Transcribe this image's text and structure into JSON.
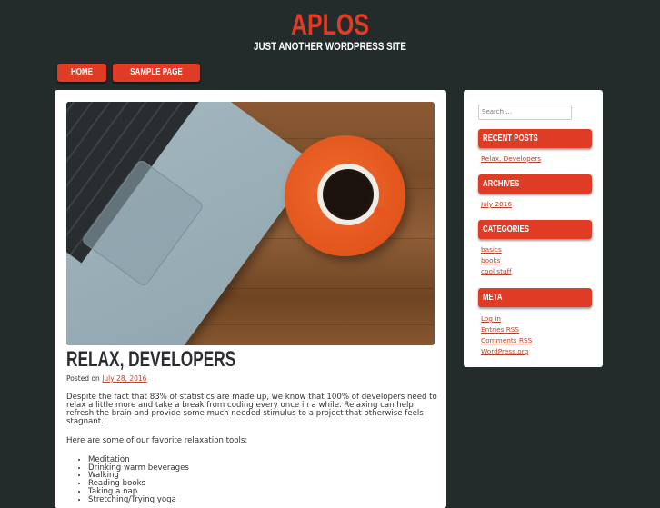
{
  "site": {
    "title": "APLOS",
    "description": "Just another WordPress site"
  },
  "nav": {
    "items": [
      {
        "label": "HOME"
      },
      {
        "label": "SAMPLE PAGE"
      }
    ]
  },
  "post": {
    "featured_image_alt": "laptop-and-coffee-photo",
    "title": "RELAX, DEVELOPERS",
    "meta_prefix": "Posted on",
    "date": "July 28, 2016",
    "paragraphs": [
      "Despite the fact that 83% of statistics are made up, we know that 100% of developers need to relax a little more and take a break from coding every once in a while. Relaxing can help refresh the brain and provide some much needed stimulus to a project that otherwise feels stagnant.",
      "Here are some of our favorite relaxation tools:"
    ],
    "list": [
      "Meditation",
      "Drinking warm beverages",
      "Walking",
      "Reading books",
      "Taking a nap",
      "Stretching/Trying yoga"
    ]
  },
  "sidebar": {
    "search_placeholder": "Search ...",
    "widgets": [
      {
        "title": "RECENT POSTS",
        "items": [
          "Relax, Developers"
        ]
      },
      {
        "title": "ARCHIVES",
        "items": [
          "July 2016"
        ]
      },
      {
        "title": "CATEGORIES",
        "items": [
          "basics",
          "books",
          "cool stuff"
        ]
      },
      {
        "title": "META",
        "items": [
          "Log in",
          "Entries RSS",
          "Comments RSS",
          "WordPress.org"
        ]
      }
    ]
  },
  "colors": {
    "background": "#242b2b",
    "accent": "#e03c25",
    "link": "#b8412b",
    "panel": "#ffffff"
  }
}
